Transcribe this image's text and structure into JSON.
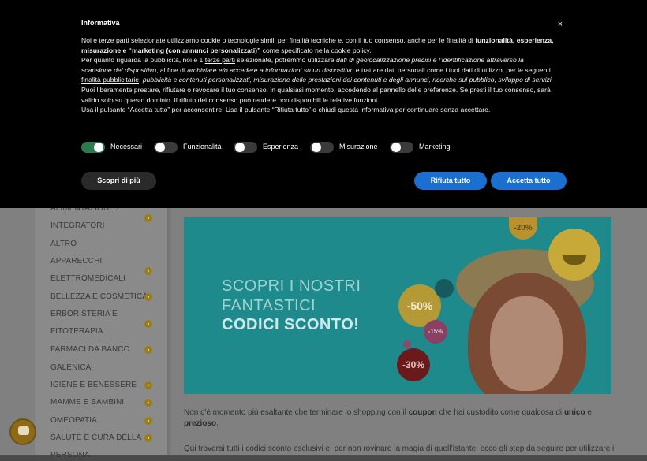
{
  "cookie": {
    "title": "Informativa",
    "close": "×",
    "p1_a": "Noi e terze parti selezionate utilizziamo cookie o tecnologie simili per finalità tecniche e, con il tuo consenso, anche per le finalità di ",
    "p1_b": "funzionalità, esperienza, misurazione e “marketing (con annunci personalizzati)”",
    "p1_c": " come specificato nella ",
    "p1_link": "cookie policy",
    "p1_d": ".",
    "p2_a": "Per quanto riguarda la pubblicità, noi e 1 ",
    "p2_link": "terze parti",
    "p2_b": " selezionate, potremmo utilizzare ",
    "p2_c": "dati di geolocalizzazione precisi e l’identificazione attraverso la scansione del dispositivo",
    "p2_d": ", al fine di ",
    "p2_e": "archiviare e/o accedere a informazioni su un dispositivo",
    "p2_f": " e trattare dati personali come i tuoi dati di utilizzo, per le seguenti ",
    "p2_link2": "finalità pubblicitarie",
    "p2_g": ": ",
    "p2_h": "pubblicità e contenuti personalizzati, misurazione delle prestazioni dei contenuti e degli annunci, ricerche sul pubblico, sviluppo di servizi.",
    "p3": "Puoi liberamente prestare, rifiutare o revocare il tuo consenso, in qualsiasi momento, accedendo al pannello delle preferenze. Se presti il tuo consenso, sarà valido solo su questo dominio. Il rifiuto del consenso può rendere non disponibili le relative funzioni.",
    "p4": "Usa il pulsante “Accetta tutto” per acconsentire. Usa il pulsante “Rifiuta tutto” o chiudi questa informativa per continuare senza accettare.",
    "toggles": {
      "necessari": "Necessari",
      "funzionalita": "Funzionalità",
      "esperienza": "Esperienza",
      "misurazione": "Misurazione",
      "marketing": "Marketing"
    },
    "btn_more": "Scopri di più",
    "btn_reject": "Rifiuta tutto",
    "btn_accept": "Accetta tutto"
  },
  "sidebar": {
    "items": [
      "ALIMENTAZIONE E",
      "INTEGRATORI",
      "ALTRO",
      "APPARECCHI",
      "ELETTROMEDICALI",
      "BELLEZZA E COSMETICA",
      "ERBORISTERIA E",
      "FITOTERAPIA",
      "FARMACI DA BANCO",
      "GALENICA",
      "IGIENE E BENESSERE",
      "MAMME E BAMBINI",
      "OMEOPATIA",
      "SALUTE E CURA DELLA",
      "PERSONA"
    ],
    "arrow": "›"
  },
  "banner": {
    "line1": "SCOPRI I NOSTRI",
    "line2": "FANTASTICI",
    "line3": "CODICI SCONTO!",
    "d20": "-20%",
    "d50": "-50%",
    "d15": "-15%",
    "d30": "-30%"
  },
  "article": {
    "p1_a": "Non c’è momento più esaltante che terminare lo shopping con il ",
    "p1_b": "coupon",
    "p1_c": " che hai custodito come qualcosa di ",
    "p1_d": "unico",
    "p1_e": " e ",
    "p1_f": "prezioso",
    "p1_g": ".",
    "p2": "Qui troverai tutti i codici sconto esclusivi e, per non rovinare la magia di quell’istante, ecco gli step da seguire per utilizzare il"
  }
}
